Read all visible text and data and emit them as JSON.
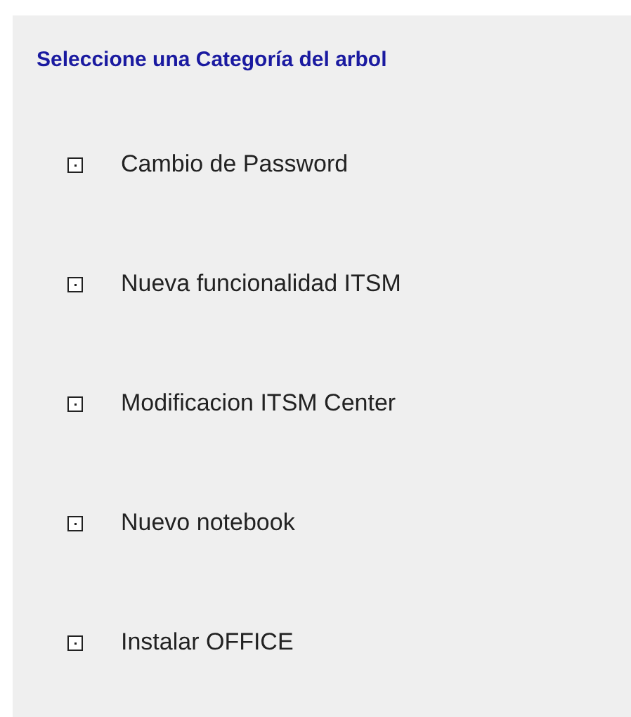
{
  "title": "Seleccione una Categoría del arbol",
  "items": [
    {
      "label": "Cambio de Password"
    },
    {
      "label": "Nueva funcionalidad ITSM"
    },
    {
      "label": "Modificacion ITSM Center"
    },
    {
      "label": "Nuevo notebook"
    },
    {
      "label": "Instalar OFFICE"
    }
  ]
}
